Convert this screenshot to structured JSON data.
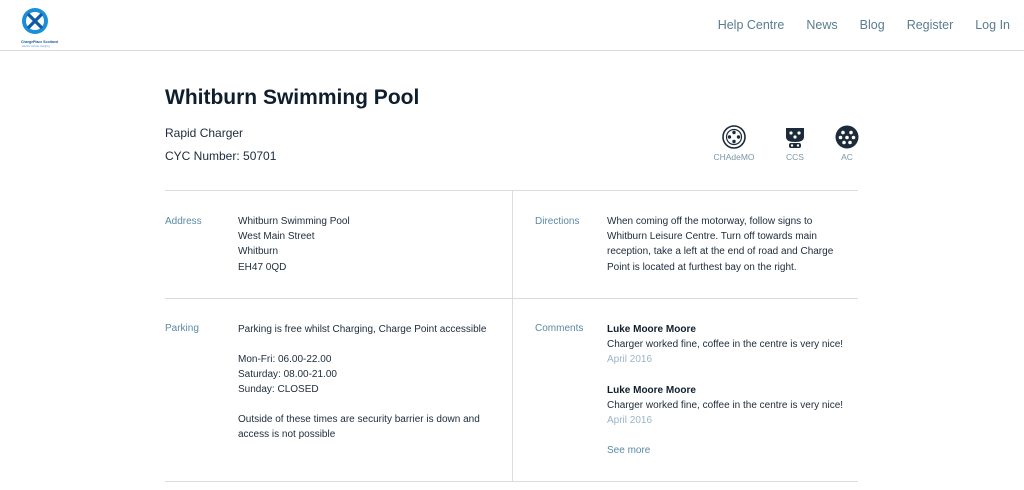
{
  "header": {
    "logo": {
      "name": "ChargePlace Scotland",
      "tagline": "electric vehicle charging"
    },
    "nav": [
      "Help Centre",
      "News",
      "Blog",
      "Register",
      "Log In"
    ]
  },
  "location": {
    "title": "Whitburn Swimming Pool",
    "charger_type": "Rapid Charger",
    "cyc_number": "CYC Number: 50701"
  },
  "connectors": [
    {
      "label": "CHAdeMO",
      "icon": "chademo-connector-icon"
    },
    {
      "label": "CCS",
      "icon": "ccs-connector-icon"
    },
    {
      "label": "AC",
      "icon": "ac-connector-icon"
    }
  ],
  "address": {
    "label": "Address",
    "lines": [
      "Whitburn Swimming Pool",
      "West Main Street",
      "Whitburn",
      "EH47 0QD"
    ]
  },
  "directions": {
    "label": "Directions",
    "lines": [
      "When coming off the motorway, follow signs to",
      "Whitburn Leisure Centre. Turn off towards main",
      "reception, take a left at the end of road and Charge",
      "Point is located at furthest bay on the right."
    ]
  },
  "parking": {
    "label": "Parking",
    "intro": "Parking is free whilst Charging, Charge Point accessible",
    "hours": [
      "Mon-Fri: 06.00-22.00",
      "Saturday: 08.00-21.00",
      "Sunday: CLOSED"
    ],
    "note_lines": [
      "Outside of these times are security barrier is down and",
      "access is not possible"
    ]
  },
  "comments": {
    "label": "Comments",
    "items": [
      {
        "author": "Luke Moore Moore",
        "text": "Charger worked fine, coffee in the centre is very nice!",
        "date": "April 2016"
      },
      {
        "author": "Luke Moore Moore",
        "text": "Charger worked fine, coffee in the centre is very nice!",
        "date": "April 2016"
      }
    ],
    "see_more": "See more"
  },
  "colors": {
    "title": "#0f1e2d",
    "label_accent": "#5a8aa3",
    "date": "#9ab5c8",
    "nav": "#5a7d8e",
    "divider": "#dcdcdc",
    "logo_blue": "#1a8fd6"
  }
}
